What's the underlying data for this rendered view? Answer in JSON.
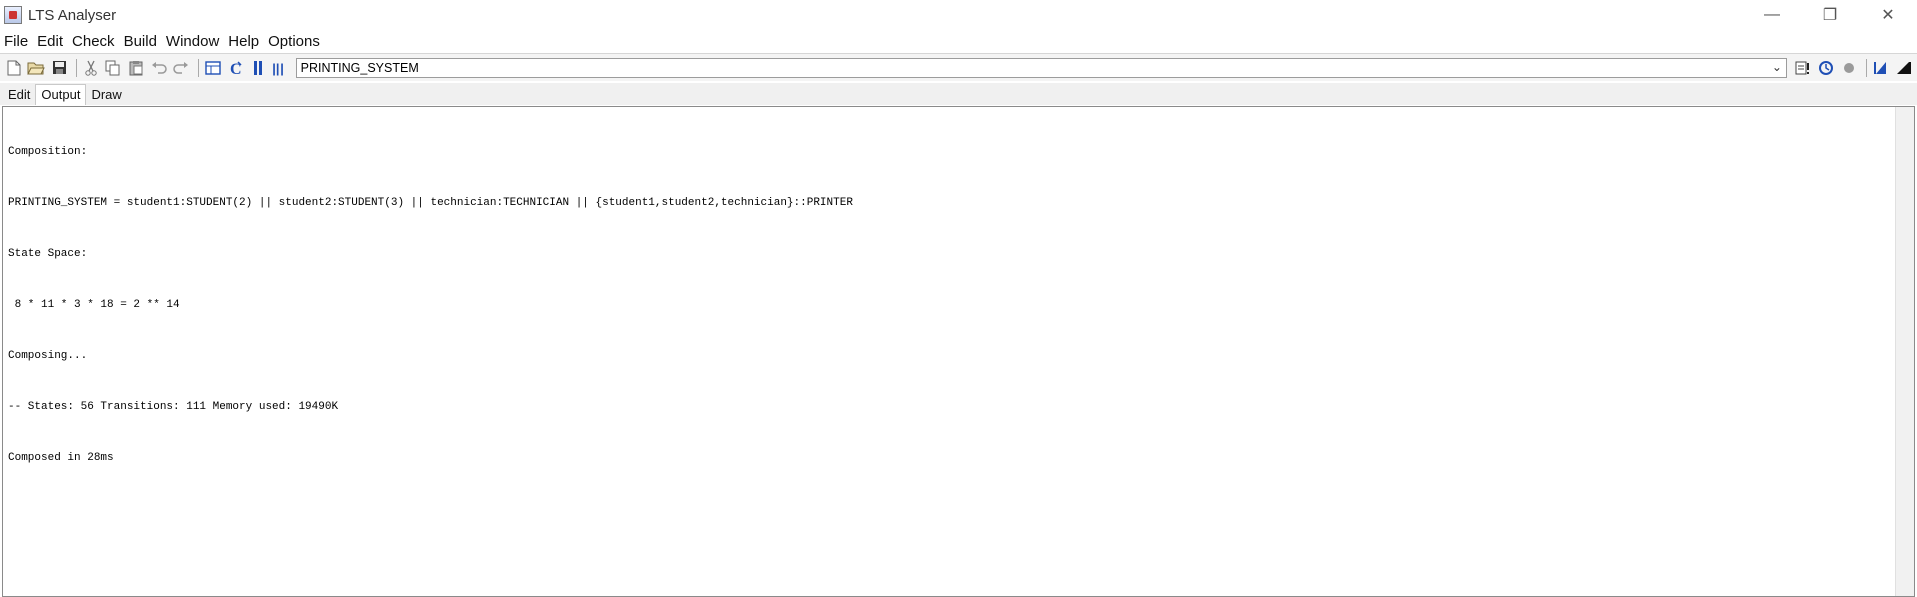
{
  "window": {
    "title": "LTS Analyser",
    "controls": {
      "minimize": "—",
      "restore": "❐",
      "close": "✕"
    }
  },
  "menu": [
    "File",
    "Edit",
    "Check",
    "Build",
    "Window",
    "Help",
    "Options"
  ],
  "toolbar": {
    "left_icons": [
      "new-file-icon",
      "open-folder-icon",
      "save-icon",
      "cut-icon",
      "copy-icon",
      "paste-icon",
      "undo-icon",
      "redo-icon",
      "table-icon",
      "compile-icon",
      "parse-icon",
      "compose-icon"
    ],
    "right_icons": [
      "safety-check-icon",
      "progress-icon",
      "stop-icon",
      "minimise-icon",
      "minimise-all-icon"
    ],
    "target_value": "PRINTING_SYSTEM"
  },
  "tabs": [
    "Edit",
    "Output",
    "Draw"
  ],
  "active_tab": "Output",
  "output": {
    "lines": [
      "Composition:",
      "PRINTING_SYSTEM = student1:STUDENT(2) || student2:STUDENT(3) || technician:TECHNICIAN || {student1,student2,technician}::PRINTER",
      "State Space:",
      " 8 * 11 * 3 * 18 = 2 ** 14",
      "Composing...",
      "-- States: 56 Transitions: 111 Memory used: 19490K",
      "Composed in 28ms"
    ]
  },
  "colors": {
    "accent": "#1f4fb5",
    "toolbar_bg": "#f4f4f4",
    "tab_bg": "#f0f0f0"
  }
}
